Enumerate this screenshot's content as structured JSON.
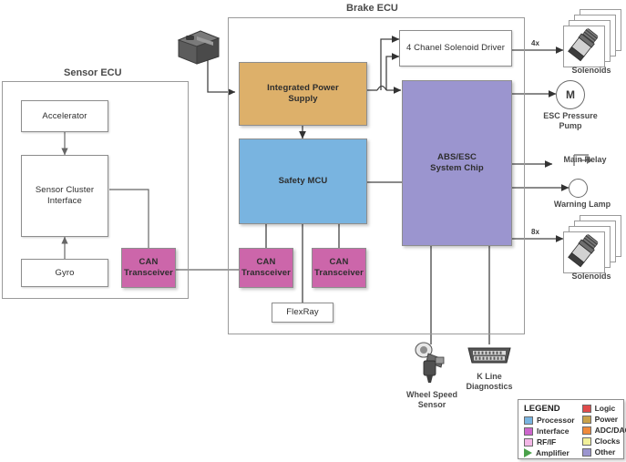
{
  "diagram": {
    "groups": [
      {
        "id": "sensor_ecu",
        "title": "Sensor ECU"
      },
      {
        "id": "brake_ecu",
        "title": "Brake ECU"
      }
    ],
    "sensor_ecu": {
      "title": "Sensor ECU",
      "blocks": [
        {
          "name": "accelerator",
          "label": "Accelerator",
          "category": "Other",
          "color": "#ffffff"
        },
        {
          "name": "sensor-cluster-interface",
          "label": "Sensor Cluster\nInterface",
          "category": "Other",
          "color": "#ffffff"
        },
        {
          "name": "gyro",
          "label": "Gyro",
          "category": "Other",
          "color": "#ffffff"
        },
        {
          "name": "can-transceiver-sensor",
          "label": "CAN\nTransceiver",
          "category": "RF/IF",
          "color": "#cc66aa"
        }
      ]
    },
    "brake_ecu": {
      "title": "Brake ECU",
      "blocks": [
        {
          "name": "integrated-power-supply",
          "label": "Integrated Power\nSupply",
          "category": "Power",
          "color": "#ddb06a"
        },
        {
          "name": "safety-mcu",
          "label": "Safety MCU",
          "category": "Processor",
          "color": "#79b4e0"
        },
        {
          "name": "abs-esc-system-chip",
          "label": "ABS/ESC\nSystem Chip",
          "category": "Other",
          "color": "#9b95cf"
        },
        {
          "name": "solenoid-driver",
          "label": "4 Chanel Solenoid Driver",
          "category": "Other",
          "color": "#ffffff"
        },
        {
          "name": "can-transceiver-left",
          "label": "CAN\nTransceiver",
          "category": "RF/IF",
          "color": "#cc66aa"
        },
        {
          "name": "can-transceiver-right",
          "label": "CAN\nTransceiver",
          "category": "RF/IF",
          "color": "#cc66aa"
        },
        {
          "name": "flexray",
          "label": "FlexRay",
          "category": "Other",
          "color": "#ffffff"
        }
      ]
    },
    "peripherals": [
      {
        "name": "solenoids-top",
        "label": "Solenoids",
        "multiplier": "4x",
        "icon": "solenoid-stack-icon"
      },
      {
        "name": "esc-pressure-pump",
        "label": "ESC Pressure\nPump",
        "multiplier": "",
        "icon": "motor-icon",
        "symbol": "M"
      },
      {
        "name": "main-relay",
        "label": "Main Relay",
        "multiplier": "",
        "icon": "relay-icon"
      },
      {
        "name": "warning-lamp",
        "label": "Warning Lamp",
        "multiplier": "",
        "icon": "lamp-icon"
      },
      {
        "name": "solenoids-bottom",
        "label": "Solenoids",
        "multiplier": "8x",
        "icon": "solenoid-stack-icon"
      },
      {
        "name": "wheel-speed-sensor",
        "label": "Wheel Speed\nSensor",
        "multiplier": "",
        "icon": "wheel-speed-sensor-icon"
      },
      {
        "name": "k-line-diagnostics",
        "label": "K Line\nDiagnostics",
        "multiplier": "",
        "icon": "obd-connector-icon"
      },
      {
        "name": "battery",
        "label": "",
        "multiplier": "",
        "icon": "battery-icon"
      }
    ],
    "legend": {
      "title": "LEGEND",
      "left": [
        {
          "label": "Processor",
          "color": "#79b4e0",
          "shape": "square"
        },
        {
          "label": "Interface",
          "color": "#cc66cc",
          "shape": "square"
        },
        {
          "label": "RF/IF",
          "color": "#f2b6e6",
          "shape": "square"
        },
        {
          "label": "Amplifier",
          "color": "#4aa14a",
          "shape": "triangle"
        }
      ],
      "right": [
        {
          "label": "Logic",
          "color": "#e04b4b",
          "shape": "square"
        },
        {
          "label": "Power",
          "color": "#c9a24b",
          "shape": "square"
        },
        {
          "label": "ADC/DAC",
          "color": "#ef8a3c",
          "shape": "square"
        },
        {
          "label": "Clocks",
          "color": "#f2f09a",
          "shape": "square"
        },
        {
          "label": "Other",
          "color": "#9b95cf",
          "shape": "square"
        }
      ]
    }
  }
}
